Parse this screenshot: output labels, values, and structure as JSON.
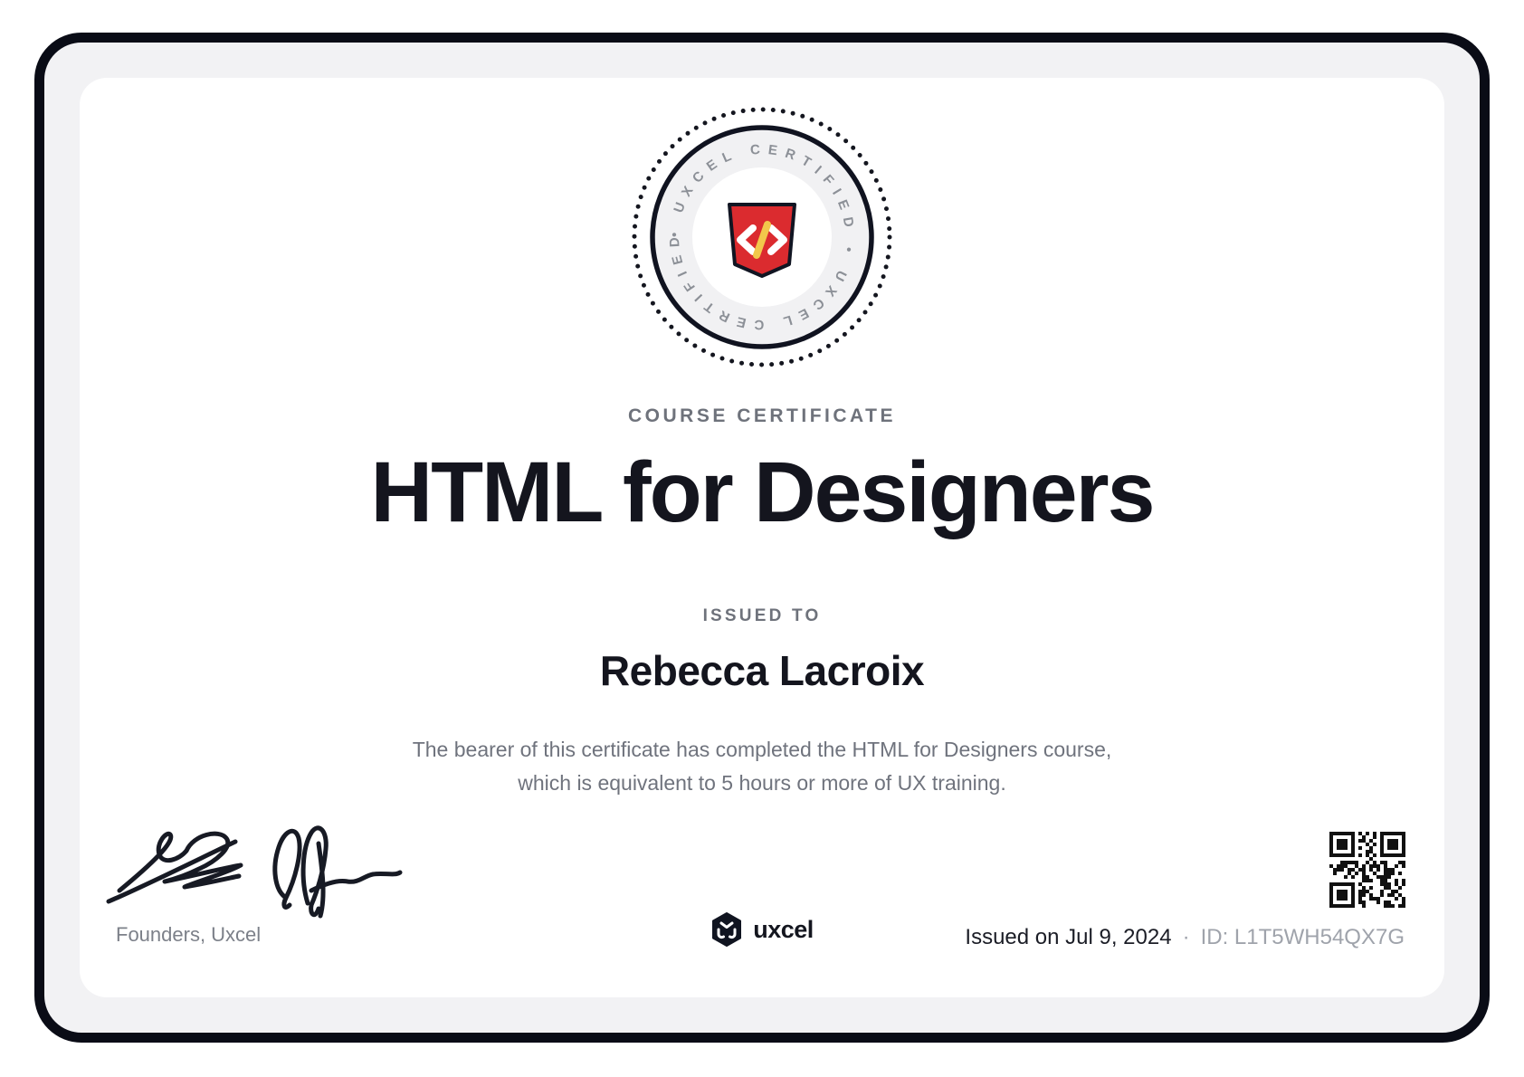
{
  "colors": {
    "ink": "#14151E",
    "frame_dark": "#0A0C16",
    "frame_gray": "#F2F2F4",
    "muted_gray": "#6F737D",
    "shield_red": "#DB2B2F",
    "slash_yellow": "#F2C84B"
  },
  "badge": {
    "ring_text": "• UXCEL CERTIFIED • UXCEL CERTIFIED",
    "center_icon": "code-shield-icon"
  },
  "header": {
    "eyebrow": "COURSE CERTIFICATE",
    "title": "HTML for Designers"
  },
  "recipient": {
    "label": "ISSUED TO",
    "name": "Rebecca Lacroix"
  },
  "description": {
    "line1": "The bearer of this certificate has completed the HTML for Designers course,",
    "line2": "which is equivalent to 5 hours or more of UX training."
  },
  "signature": {
    "caption": "Founders, Uxcel"
  },
  "brand": {
    "wordmark": "uxcel"
  },
  "footer": {
    "issued_on": "Issued on Jul 9, 2024",
    "separator": "·",
    "id": "ID: L1T5WH54QX7G"
  }
}
